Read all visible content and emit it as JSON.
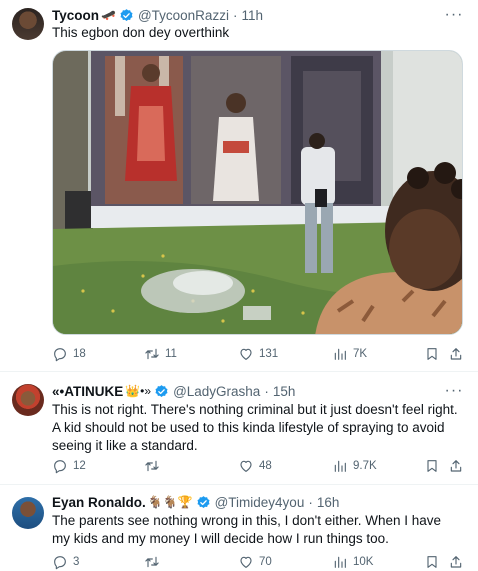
{
  "tweets": [
    {
      "name": "Tycoon",
      "name_emoji": "🛹",
      "handle": "@TycoonRazzi",
      "time": "11h",
      "text": "This egbon don dey overthink",
      "stats": {
        "replies": "18",
        "retweets": "11",
        "likes": "131",
        "views": "7K"
      }
    },
    {
      "name": "«•ATINUKE",
      "name_emoji": "👑•»",
      "handle": "@LadyGrasha",
      "time": "15h",
      "text": "This is not right. There's nothing criminal but it just doesn't feel right. A kid should not be used to this kinda lifestyle of spraying to avoid seeing it like a standard.",
      "stats": {
        "replies": "12",
        "retweets": "",
        "likes": "48",
        "views": "9.7K"
      }
    },
    {
      "name": "Eyan Ronaldo.",
      "name_emoji": "🐐🐐🏆",
      "handle": "@Timidey4you",
      "time": "16h",
      "text": "The parents see nothing wrong in this, I don't either. When I have my kids and my money I will decide how I run things too.",
      "stats": {
        "replies": "3",
        "retweets": "",
        "likes": "70",
        "views": "10K"
      }
    }
  ],
  "separator": "·",
  "more_glyph": "···",
  "colors": {
    "verified": "#1d9bf0",
    "muted": "#536471",
    "text": "#0f1419",
    "border": "#eff3f4"
  },
  "icons": [
    "reply-icon",
    "retweet-icon",
    "like-icon",
    "views-icon",
    "bookmark-icon",
    "share-icon",
    "verified-badge-icon",
    "more-icon"
  ]
}
